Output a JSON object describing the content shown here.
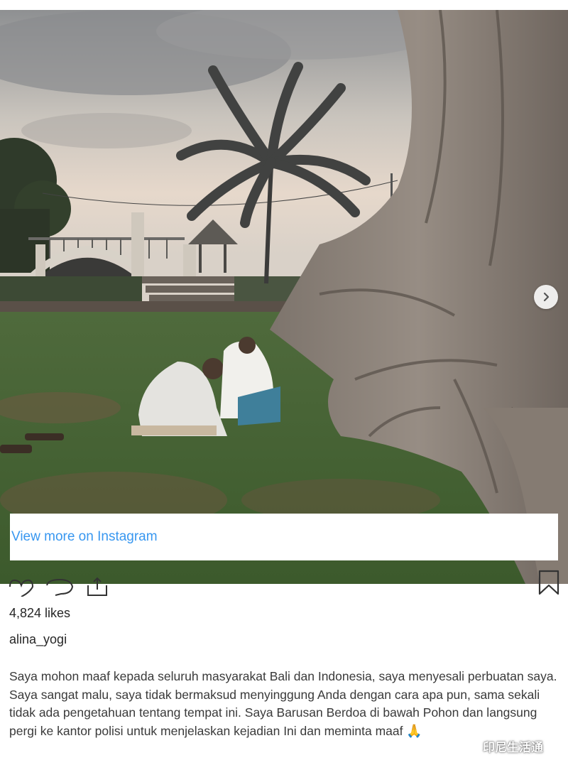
{
  "post": {
    "view_more_label": "View more on Instagram",
    "likes": "4,824 likes",
    "username": "alina_yogi",
    "caption": "Saya mohon maaf kepada seluruh masyarakat Bali dan Indonesia, saya menyesali perbuatan saya. Saya sangat malu, saya tidak bermaksud menyinggung Anda dengan cara apa pun, sama sekali tidak ada pengetahuan tentang tempat ini. Saya Barusan Berdoa di bawah Pohon dan langsung pergi ke kantor polisi untuk menjelaskan kejadian Ini dan meminta maaf",
    "caption_emoji": "🙏"
  },
  "icons": {
    "next": "chevron-right-icon",
    "like": "heart-icon",
    "comment": "comment-icon",
    "share": "share-icon",
    "save": "bookmark-icon"
  },
  "watermark": {
    "text": "印尼生活通"
  },
  "colors": {
    "link": "#3897f0",
    "text": "#262626"
  }
}
